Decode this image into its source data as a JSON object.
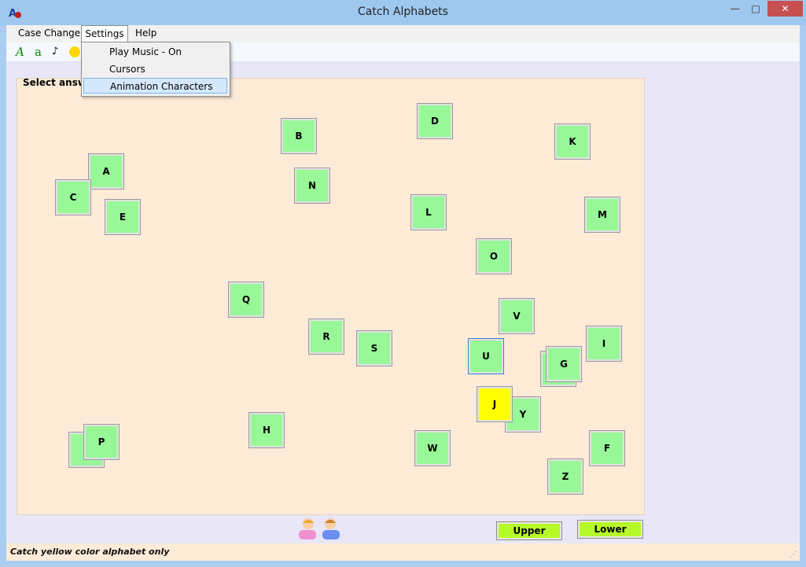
{
  "window": {
    "title": "Catch Alphabets",
    "min": "—",
    "max": "□",
    "close": "✕"
  },
  "menubar": {
    "case_change": "Case Change",
    "settings": "Settings",
    "help": "Help"
  },
  "toolbar": {
    "upper_glyph": "A",
    "lower_glyph": "a",
    "music_glyph": "♪"
  },
  "dropdown": {
    "items": [
      "Play Music - On",
      "Cursors",
      "Animation Characters"
    ]
  },
  "board": {
    "prompt": "Select answer",
    "tiles": [
      "D",
      "B",
      "K",
      "A",
      "N",
      "C",
      "E",
      "L",
      "M",
      "O",
      "Q",
      "V",
      "R",
      "S",
      "U",
      "I",
      "G",
      "J",
      "Y",
      "H",
      "P",
      "W",
      "F",
      "Z"
    ],
    "highlight": "J"
  },
  "buttons": {
    "upper": "Upper",
    "lower": "Lower"
  },
  "status": {
    "text": "Catch yellow color alphabet only"
  },
  "colors": {
    "tile": "#98f898",
    "target": "#ffff00",
    "board": "#fdebd8",
    "case_button": "#b6f928"
  }
}
